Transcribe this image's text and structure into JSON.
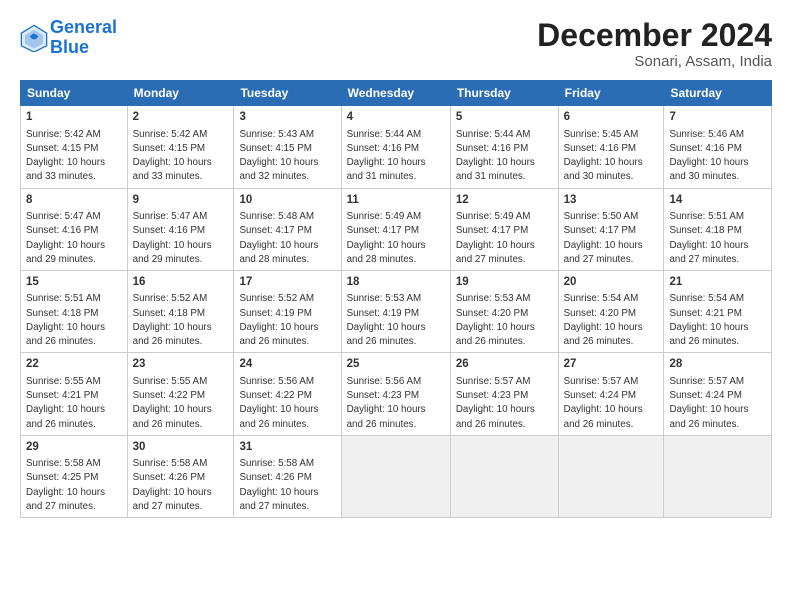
{
  "header": {
    "logo_line1": "General",
    "logo_line2": "Blue",
    "month_title": "December 2024",
    "location": "Sonari, Assam, India"
  },
  "weekdays": [
    "Sunday",
    "Monday",
    "Tuesday",
    "Wednesday",
    "Thursday",
    "Friday",
    "Saturday"
  ],
  "weeks": [
    [
      {
        "day": "1",
        "detail": "Sunrise: 5:42 AM\nSunset: 4:15 PM\nDaylight: 10 hours\nand 33 minutes."
      },
      {
        "day": "2",
        "detail": "Sunrise: 5:42 AM\nSunset: 4:15 PM\nDaylight: 10 hours\nand 33 minutes."
      },
      {
        "day": "3",
        "detail": "Sunrise: 5:43 AM\nSunset: 4:15 PM\nDaylight: 10 hours\nand 32 minutes."
      },
      {
        "day": "4",
        "detail": "Sunrise: 5:44 AM\nSunset: 4:16 PM\nDaylight: 10 hours\nand 31 minutes."
      },
      {
        "day": "5",
        "detail": "Sunrise: 5:44 AM\nSunset: 4:16 PM\nDaylight: 10 hours\nand 31 minutes."
      },
      {
        "day": "6",
        "detail": "Sunrise: 5:45 AM\nSunset: 4:16 PM\nDaylight: 10 hours\nand 30 minutes."
      },
      {
        "day": "7",
        "detail": "Sunrise: 5:46 AM\nSunset: 4:16 PM\nDaylight: 10 hours\nand 30 minutes."
      }
    ],
    [
      {
        "day": "8",
        "detail": "Sunrise: 5:47 AM\nSunset: 4:16 PM\nDaylight: 10 hours\nand 29 minutes."
      },
      {
        "day": "9",
        "detail": "Sunrise: 5:47 AM\nSunset: 4:16 PM\nDaylight: 10 hours\nand 29 minutes."
      },
      {
        "day": "10",
        "detail": "Sunrise: 5:48 AM\nSunset: 4:17 PM\nDaylight: 10 hours\nand 28 minutes."
      },
      {
        "day": "11",
        "detail": "Sunrise: 5:49 AM\nSunset: 4:17 PM\nDaylight: 10 hours\nand 28 minutes."
      },
      {
        "day": "12",
        "detail": "Sunrise: 5:49 AM\nSunset: 4:17 PM\nDaylight: 10 hours\nand 27 minutes."
      },
      {
        "day": "13",
        "detail": "Sunrise: 5:50 AM\nSunset: 4:17 PM\nDaylight: 10 hours\nand 27 minutes."
      },
      {
        "day": "14",
        "detail": "Sunrise: 5:51 AM\nSunset: 4:18 PM\nDaylight: 10 hours\nand 27 minutes."
      }
    ],
    [
      {
        "day": "15",
        "detail": "Sunrise: 5:51 AM\nSunset: 4:18 PM\nDaylight: 10 hours\nand 26 minutes."
      },
      {
        "day": "16",
        "detail": "Sunrise: 5:52 AM\nSunset: 4:18 PM\nDaylight: 10 hours\nand 26 minutes."
      },
      {
        "day": "17",
        "detail": "Sunrise: 5:52 AM\nSunset: 4:19 PM\nDaylight: 10 hours\nand 26 minutes."
      },
      {
        "day": "18",
        "detail": "Sunrise: 5:53 AM\nSunset: 4:19 PM\nDaylight: 10 hours\nand 26 minutes."
      },
      {
        "day": "19",
        "detail": "Sunrise: 5:53 AM\nSunset: 4:20 PM\nDaylight: 10 hours\nand 26 minutes."
      },
      {
        "day": "20",
        "detail": "Sunrise: 5:54 AM\nSunset: 4:20 PM\nDaylight: 10 hours\nand 26 minutes."
      },
      {
        "day": "21",
        "detail": "Sunrise: 5:54 AM\nSunset: 4:21 PM\nDaylight: 10 hours\nand 26 minutes."
      }
    ],
    [
      {
        "day": "22",
        "detail": "Sunrise: 5:55 AM\nSunset: 4:21 PM\nDaylight: 10 hours\nand 26 minutes."
      },
      {
        "day": "23",
        "detail": "Sunrise: 5:55 AM\nSunset: 4:22 PM\nDaylight: 10 hours\nand 26 minutes."
      },
      {
        "day": "24",
        "detail": "Sunrise: 5:56 AM\nSunset: 4:22 PM\nDaylight: 10 hours\nand 26 minutes."
      },
      {
        "day": "25",
        "detail": "Sunrise: 5:56 AM\nSunset: 4:23 PM\nDaylight: 10 hours\nand 26 minutes."
      },
      {
        "day": "26",
        "detail": "Sunrise: 5:57 AM\nSunset: 4:23 PM\nDaylight: 10 hours\nand 26 minutes."
      },
      {
        "day": "27",
        "detail": "Sunrise: 5:57 AM\nSunset: 4:24 PM\nDaylight: 10 hours\nand 26 minutes."
      },
      {
        "day": "28",
        "detail": "Sunrise: 5:57 AM\nSunset: 4:24 PM\nDaylight: 10 hours\nand 26 minutes."
      }
    ],
    [
      {
        "day": "29",
        "detail": "Sunrise: 5:58 AM\nSunset: 4:25 PM\nDaylight: 10 hours\nand 27 minutes."
      },
      {
        "day": "30",
        "detail": "Sunrise: 5:58 AM\nSunset: 4:26 PM\nDaylight: 10 hours\nand 27 minutes."
      },
      {
        "day": "31",
        "detail": "Sunrise: 5:58 AM\nSunset: 4:26 PM\nDaylight: 10 hours\nand 27 minutes."
      },
      null,
      null,
      null,
      null
    ]
  ]
}
